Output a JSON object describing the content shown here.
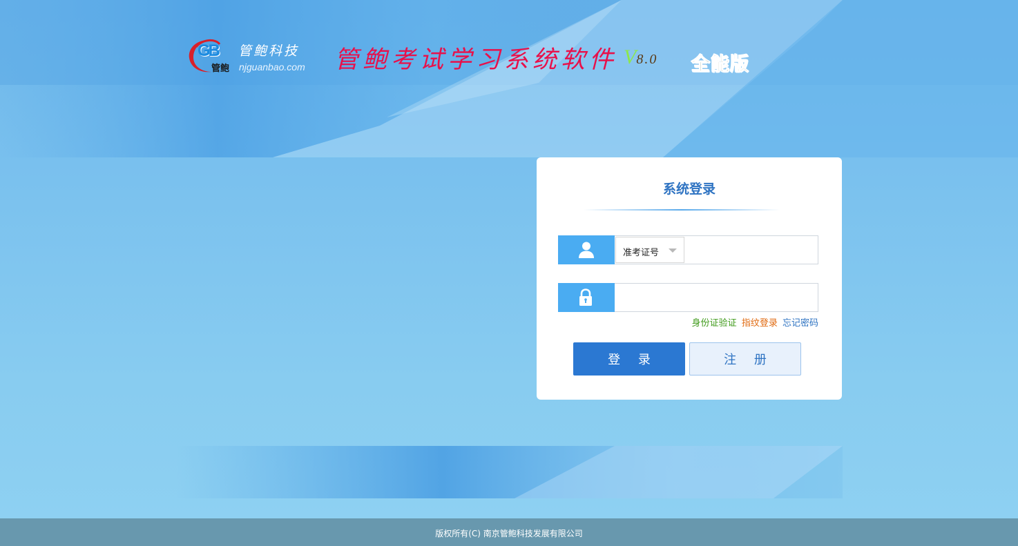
{
  "header": {
    "logo": {
      "mark": "GB",
      "mark_cn": "管鲍",
      "company": "管鲍科技",
      "website": "njguanbao.com"
    },
    "title": "管鲍考试学习系统软件",
    "version_letter": "V",
    "version_number": "8.0",
    "edition": "全能版"
  },
  "login": {
    "title": "系统登录",
    "id_type_selected": "准考证号",
    "username_value": "",
    "password_value": "",
    "links": {
      "id_verify": "身份证验证",
      "fingerprint": "指纹登录",
      "forgot": "忘记密码"
    },
    "login_button": "登 录",
    "register_button": "注 册"
  },
  "footer": {
    "copyright": "版权所有(C) 南京管鲍科技发展有限公司"
  },
  "icons": {
    "user": "user-icon",
    "lock": "lock-icon",
    "dropdown": "chevron-down-icon"
  },
  "colors": {
    "accent": "#2b78d2",
    "icon_bg": "#4aacf2",
    "title_red": "#e8104a",
    "footer_bg": "#6898ae",
    "link_green": "#3f9a1a",
    "link_orange": "#e06a10",
    "link_blue": "#2e73c2"
  }
}
